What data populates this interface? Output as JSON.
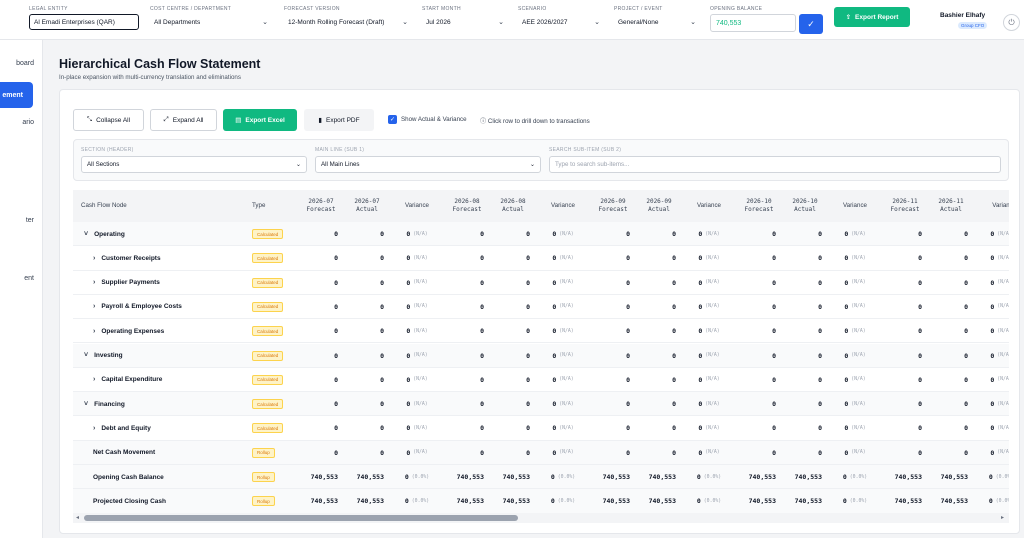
{
  "topbar": {
    "legal_entity": {
      "label": "Legal Entity",
      "value": "Al Emadi Enterprises (QAR)"
    },
    "cost_centre": {
      "label": "Cost Centre / Department",
      "value": "All Departments"
    },
    "forecast_version": {
      "label": "Forecast Version",
      "value": "12-Month Rolling Forecast (Draft)"
    },
    "start_month": {
      "label": "Start Month",
      "value": "Jul 2026"
    },
    "scenario": {
      "label": "Scenario",
      "value": "AEE 2026/2027"
    },
    "project_event": {
      "label": "Project / Event",
      "value": "General/None"
    },
    "opening_balance": {
      "label": "Opening Balance",
      "value": "740,553"
    },
    "export_report_label": "Export Report",
    "user_name": "Bashier Elhafy",
    "user_role": "Group CFO"
  },
  "sidebar": {
    "items": [
      {
        "label": "board",
        "active": false
      },
      {
        "label": "ement",
        "active": true
      },
      {
        "label": "ario",
        "active": false
      },
      {
        "label": "ter",
        "active": false
      },
      {
        "label": "ent",
        "active": false
      }
    ]
  },
  "page": {
    "title": "Hierarchical Cash Flow Statement",
    "subtitle": "In-place expansion with multi-currency translation and eliminations"
  },
  "toolbar": {
    "collapse_all": "Collapse All",
    "expand_all": "Expand All",
    "export_excel": "Export Excel",
    "export_pdf": "Export PDF",
    "show_actual_label": "Show Actual & Variance",
    "show_actual_checked": true,
    "hint": "Click row to drill down to transactions"
  },
  "filters": {
    "section": {
      "label": "Section (Header)",
      "value": "All Sections"
    },
    "main_line": {
      "label": "Main Line (Sub 1)",
      "value": "All Main Lines"
    },
    "search": {
      "label": "Search Sub-Item (Sub 2)",
      "placeholder": "Type to search sub-items..."
    }
  },
  "table": {
    "node_header": "Cash Flow Node",
    "type_header": "Type",
    "months": [
      {
        "forecast": "2026-07\nForecast",
        "actual": "2026-07\nActual",
        "variance": "Variance"
      },
      {
        "forecast": "2026-08\nForecast",
        "actual": "2026-08\nActual",
        "variance": "Variance"
      },
      {
        "forecast": "2026-09\nForecast",
        "actual": "2026-09\nActual",
        "variance": "Variance"
      },
      {
        "forecast": "2026-10\nForecast",
        "actual": "2026-10\nActual",
        "variance": "Variance"
      },
      {
        "forecast": "2026-11\nForecast",
        "actual": "2026-11\nActual",
        "variance": "Varian"
      }
    ],
    "rows": [
      {
        "node": "Operating",
        "caret": "˅",
        "level": 0,
        "kind": "section",
        "type": "Calculated",
        "f": "0",
        "a": "0",
        "v": "0",
        "vp": "(N/A)"
      },
      {
        "node": "Customer Receipts",
        "caret": "›",
        "level": 1,
        "kind": "item",
        "type": "Calculated",
        "f": "0",
        "a": "0",
        "v": "0",
        "vp": "(N/A)"
      },
      {
        "node": "Supplier Payments",
        "caret": "›",
        "level": 1,
        "kind": "item",
        "type": "Calculated",
        "f": "0",
        "a": "0",
        "v": "0",
        "vp": "(N/A)"
      },
      {
        "node": "Payroll & Employee Costs",
        "caret": "›",
        "level": 1,
        "kind": "item",
        "type": "Calculated",
        "f": "0",
        "a": "0",
        "v": "0",
        "vp": "(N/A)"
      },
      {
        "node": "Operating Expenses",
        "caret": "›",
        "level": 1,
        "kind": "item",
        "type": "Calculated",
        "f": "0",
        "a": "0",
        "v": "0",
        "vp": "(N/A)"
      },
      {
        "node": "Investing",
        "caret": "˅",
        "level": 0,
        "kind": "section",
        "type": "Calculated",
        "f": "0",
        "a": "0",
        "v": "0",
        "vp": "(N/A)"
      },
      {
        "node": "Capital Expenditure",
        "caret": "›",
        "level": 1,
        "kind": "item",
        "type": "Calculated",
        "f": "0",
        "a": "0",
        "v": "0",
        "vp": "(N/A)"
      },
      {
        "node": "Financing",
        "caret": "˅",
        "level": 0,
        "kind": "section",
        "type": "Calculated",
        "f": "0",
        "a": "0",
        "v": "0",
        "vp": "(N/A)"
      },
      {
        "node": "Debt and Equity",
        "caret": "›",
        "level": 1,
        "kind": "item",
        "type": "Calculated",
        "f": "0",
        "a": "0",
        "v": "0",
        "vp": "(N/A)"
      },
      {
        "node": "Net Cash Movement",
        "caret": "",
        "level": 1,
        "kind": "summary",
        "type": "Rollup",
        "f": "0",
        "a": "0",
        "v": "0",
        "vp": "(N/A)"
      },
      {
        "node": "Opening Cash Balance",
        "caret": "",
        "level": 1,
        "kind": "summary",
        "type": "Rollup",
        "f": "740,553",
        "a": "740,553",
        "v": "0",
        "vp": "(0.0%)"
      },
      {
        "node": "Projected Closing Cash",
        "caret": "",
        "level": 1,
        "kind": "summary",
        "type": "Rollup",
        "f": "740,553",
        "a": "740,553",
        "v": "0",
        "vp": "(0.0%)"
      }
    ]
  },
  "colors": {
    "primary": "#2563eb",
    "success": "#10b981",
    "badge_text": "#d97706"
  }
}
